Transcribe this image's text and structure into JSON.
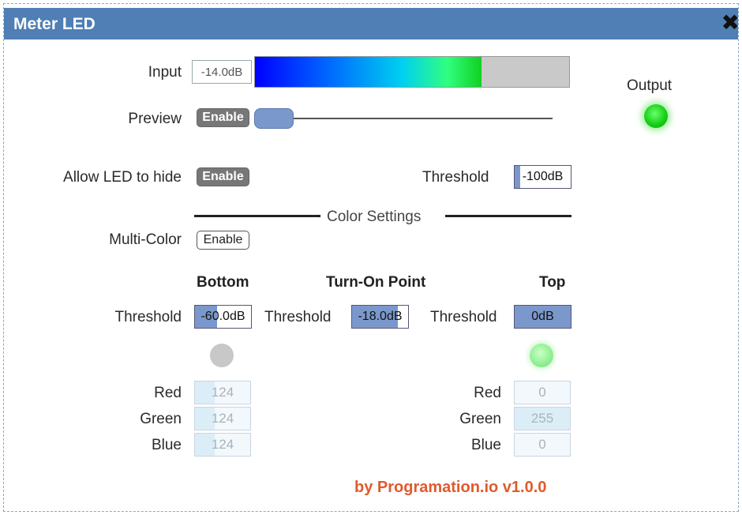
{
  "window": {
    "title": "Meter LED",
    "close_icon": "✖"
  },
  "input": {
    "label": "Input",
    "value": "-14.0dB",
    "meter_level": 0.72,
    "meter_colors": [
      "#0000ff",
      "#0060ff",
      "#00d0f0",
      "#30ff80",
      "#10d020"
    ]
  },
  "preview": {
    "label": "Preview",
    "button_label": "Enable",
    "slider_value": 0
  },
  "output": {
    "label": "Output",
    "led_color": "#18d018"
  },
  "hide": {
    "label": "Allow LED to hide",
    "button_label": "Enable"
  },
  "threshold_main": {
    "label": "Threshold",
    "value": "-100dB",
    "fill": 0.1
  },
  "color_settings": {
    "label": "Color Settings"
  },
  "multi_color": {
    "label": "Multi-Color",
    "button_label": "Enable"
  },
  "columns": {
    "bottom": {
      "header": "Bottom",
      "threshold_label": "Threshold",
      "value": "-60.0dB",
      "fill": 0.4,
      "led_color": "#c8c8c8"
    },
    "turn_on": {
      "header": "Turn-On Point",
      "threshold_label": "Threshold",
      "value": "-18.0dB",
      "fill": 0.82
    },
    "top": {
      "header": "Top",
      "threshold_label": "Threshold",
      "value": "0dB",
      "fill": 1.0,
      "led_color": "#90ee90"
    }
  },
  "rgb": {
    "labels": {
      "red": "Red",
      "green": "Green",
      "blue": "Blue"
    },
    "bottom": {
      "red": "124",
      "green": "124",
      "blue": "124"
    },
    "top": {
      "red": "0",
      "green": "255",
      "blue": "0"
    }
  },
  "credit": "by Programation.io  v1.0.0",
  "colors": {
    "titlebar": "#4f7fb4",
    "accent_fill": "#7b98cc",
    "credit": "#e05a2c"
  }
}
